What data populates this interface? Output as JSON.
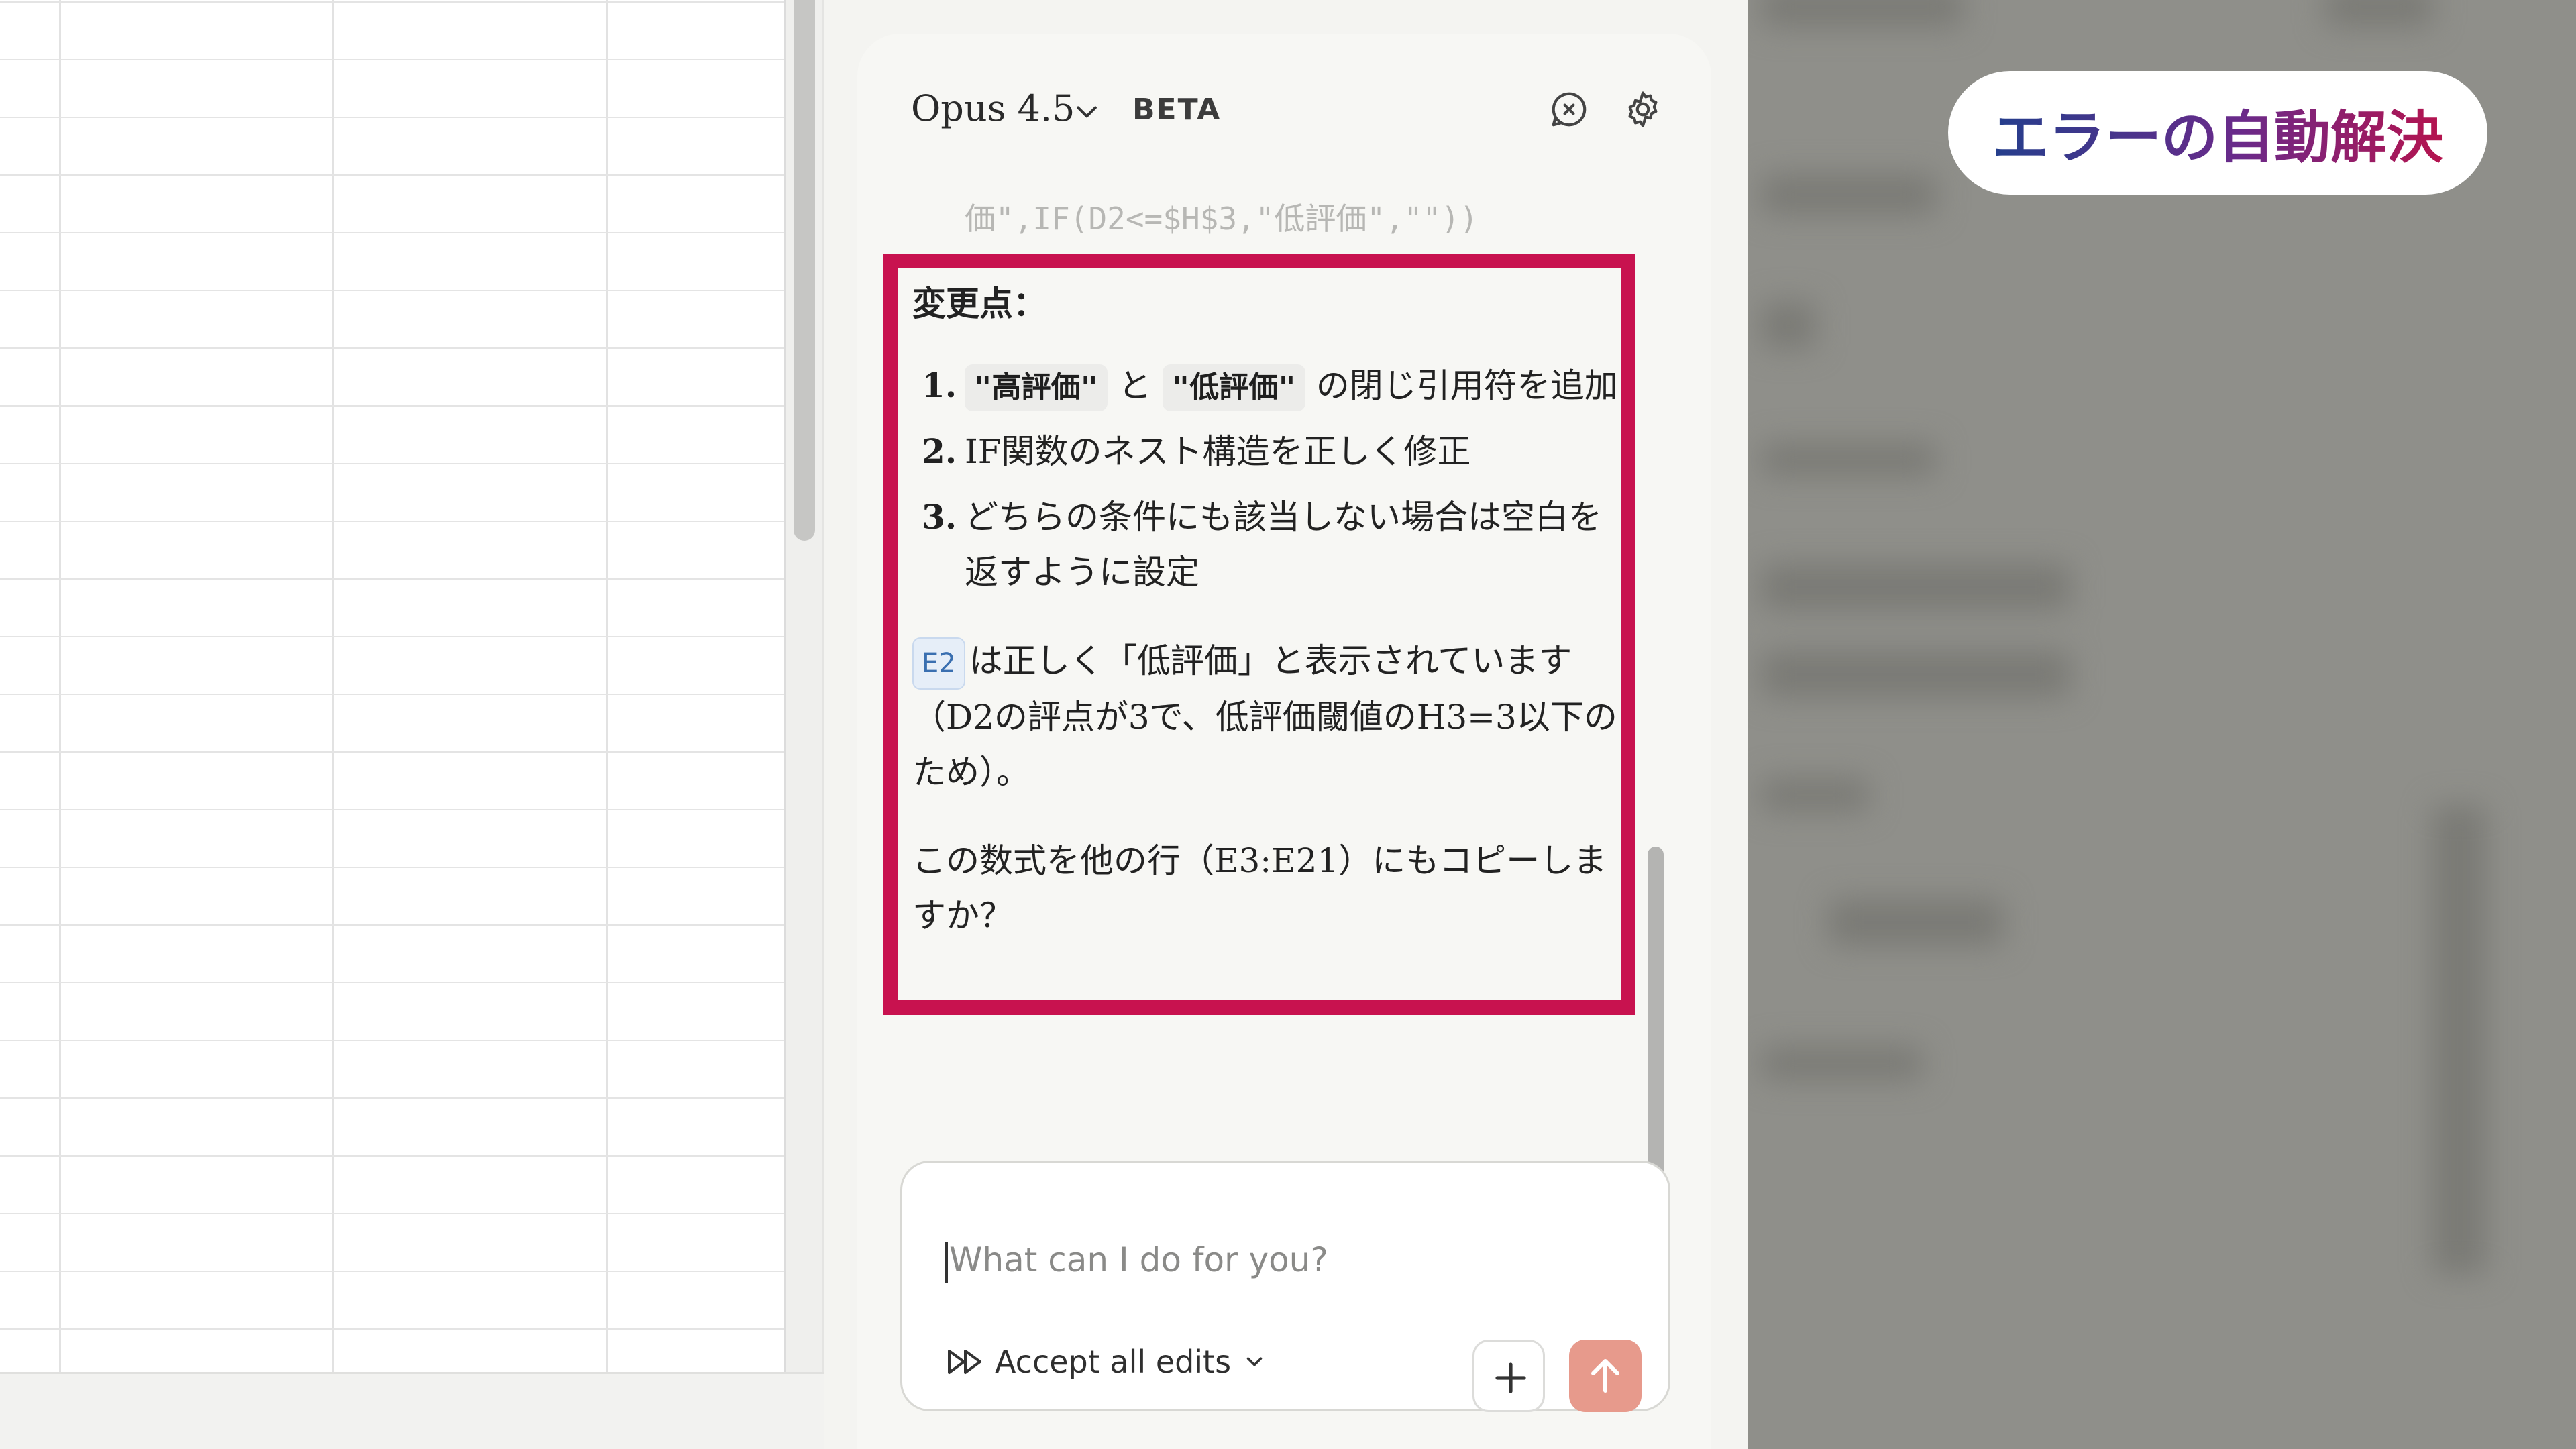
{
  "overlay": {
    "title": "エラーの自動解決"
  },
  "panel": {
    "model": "Opus 4.5",
    "beta": "BETA",
    "code_tail": "価\",IF(D2<=$H$3,\"低評価\",\"\"))",
    "changes_heading": "変更点：",
    "changes": {
      "item1": {
        "num": "1.",
        "chip1": "\"高評価\"",
        "mid": "と",
        "chip2": "\"低評価\"",
        "rest": "の閉じ引用符を追加"
      },
      "item2": {
        "num": "2.",
        "text": "IF関数のネスト構造を正しく修正"
      },
      "item3": {
        "num": "3.",
        "text": "どちらの条件にも該当しない場合は空白を返すように設定"
      }
    },
    "result": {
      "cell": "E2",
      "text": "は正しく「低評価」と表示されています（D2の評点が3で、低評価閾値のH3=3以下のため）。"
    },
    "question": "この数式を他の行（E3:E21）にもコピーしますか？",
    "composer": {
      "placeholder": "What can I do for you?",
      "accept_label": "Accept all edits"
    }
  },
  "colors": {
    "highlight": "#c8124f",
    "send": "#e79a8c"
  }
}
